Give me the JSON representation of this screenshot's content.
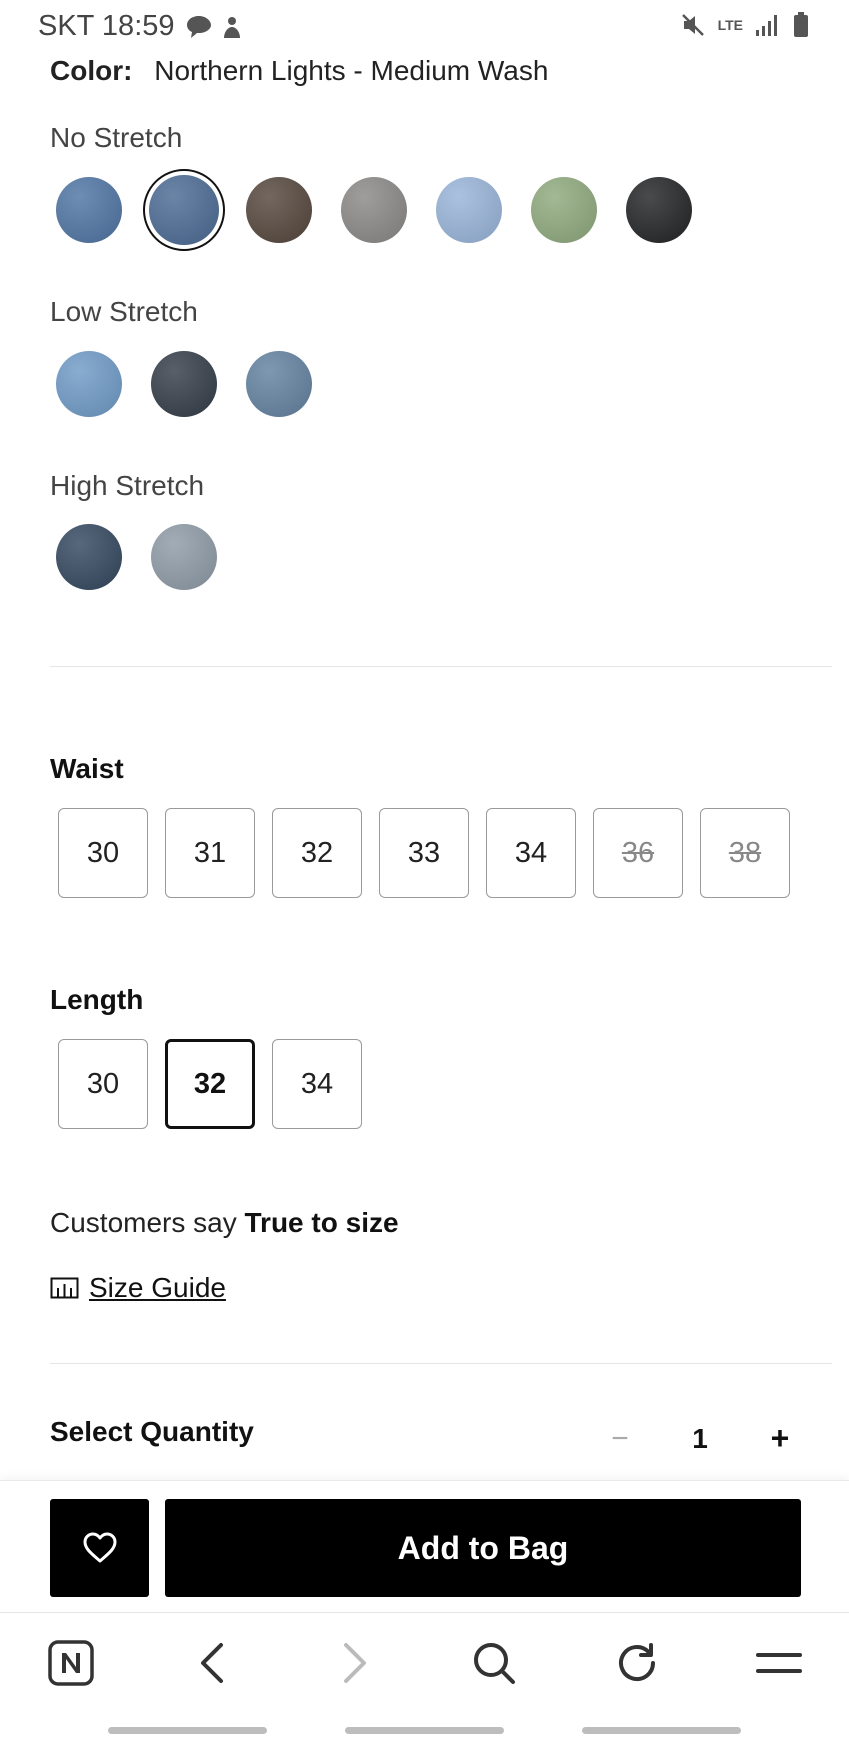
{
  "status": {
    "carrier_time": "SKT 18:59",
    "network": "LTE"
  },
  "product": {
    "color_label": "Color:",
    "color_value": "Northern Lights - Medium Wash"
  },
  "swatch_groups": [
    {
      "title": "No Stretch",
      "swatches": [
        {
          "color": "#4f74a3",
          "selected": false
        },
        {
          "color": "#4a6a93",
          "selected": true
        },
        {
          "color": "#54463c",
          "selected": false
        },
        {
          "color": "#8a8886",
          "selected": false
        },
        {
          "color": "#98b4d8",
          "selected": false
        },
        {
          "color": "#8ea97d",
          "selected": false
        },
        {
          "color": "#222325",
          "selected": false
        }
      ]
    },
    {
      "title": "Low Stretch",
      "swatches": [
        {
          "color": "#6f9ac6",
          "selected": false
        },
        {
          "color": "#333c47",
          "selected": false
        },
        {
          "color": "#6381a0",
          "selected": false
        }
      ]
    },
    {
      "title": "High Stretch",
      "swatches": [
        {
          "color": "#33475f",
          "selected": false
        },
        {
          "color": "#8d9aa6",
          "selected": false
        }
      ]
    }
  ],
  "waist": {
    "title": "Waist",
    "sizes": [
      {
        "label": "30",
        "available": true,
        "selected": false
      },
      {
        "label": "31",
        "available": true,
        "selected": false
      },
      {
        "label": "32",
        "available": true,
        "selected": false
      },
      {
        "label": "33",
        "available": true,
        "selected": false
      },
      {
        "label": "34",
        "available": true,
        "selected": false
      },
      {
        "label": "36",
        "available": false,
        "selected": false
      },
      {
        "label": "38",
        "available": false,
        "selected": false
      }
    ]
  },
  "length": {
    "title": "Length",
    "sizes": [
      {
        "label": "30",
        "available": true,
        "selected": false
      },
      {
        "label": "32",
        "available": true,
        "selected": true
      },
      {
        "label": "34",
        "available": true,
        "selected": false
      }
    ]
  },
  "fit": {
    "prefix": "Customers say ",
    "value": "True to size"
  },
  "size_guide": {
    "label": "Size Guide",
    "icon": "ruler-icon"
  },
  "quantity": {
    "title": "Select Quantity",
    "minus": "−",
    "value": "1",
    "plus": "+"
  },
  "actions": {
    "wishlist_icon": "heart-icon",
    "add_to_bag": "Add to Bag"
  },
  "browser_nav": {
    "items": [
      "home-logo-icon",
      "back-icon",
      "forward-icon",
      "search-icon",
      "reload-icon",
      "menu-icon"
    ]
  }
}
